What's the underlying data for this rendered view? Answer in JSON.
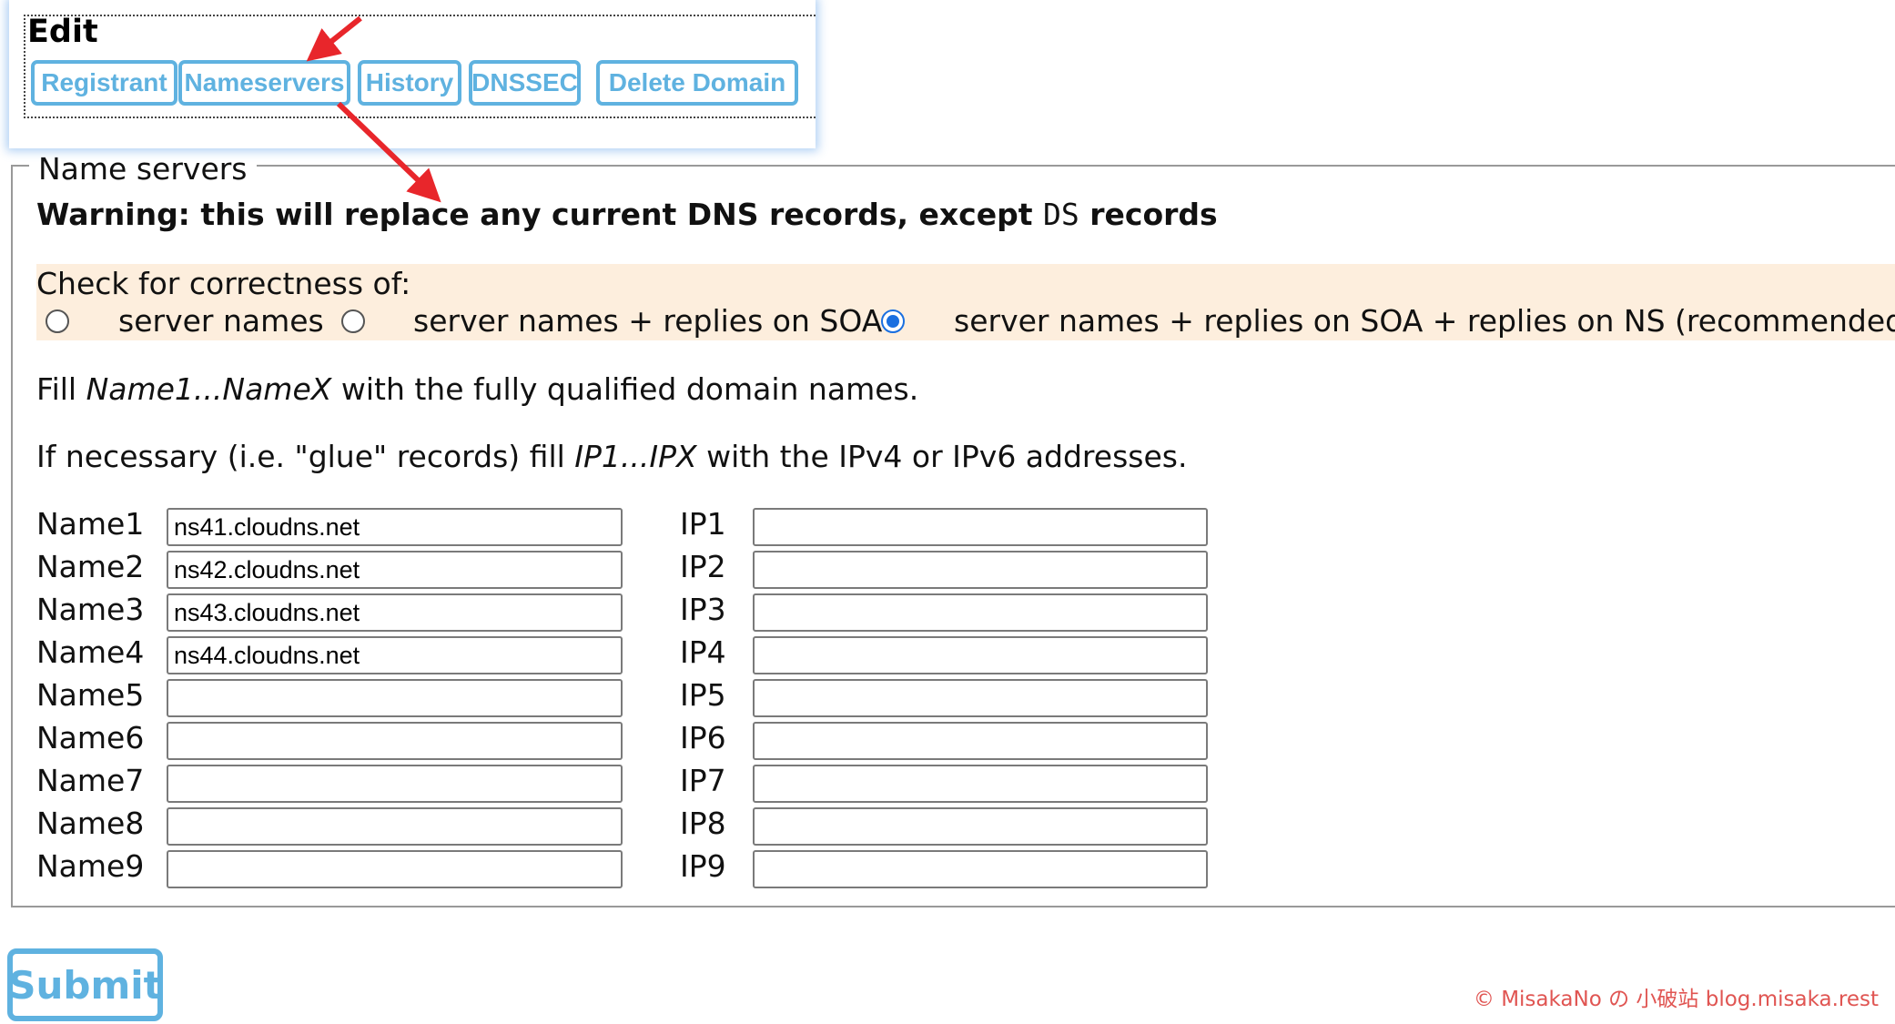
{
  "edit": {
    "title": "Edit",
    "tabs": [
      {
        "label": "Registrant"
      },
      {
        "label": "Nameservers"
      },
      {
        "label": "History"
      },
      {
        "label": "DNSSEC"
      },
      {
        "label": "Delete Domain"
      }
    ]
  },
  "nameservers": {
    "legend": "Name servers",
    "warning_prefix": "Warning: this will replace any current DNS records, except ",
    "warning_code": "DS",
    "warning_suffix": " records",
    "check_label": "Check for correctness of:",
    "check_options": [
      {
        "label": "server names",
        "selected": false
      },
      {
        "label": "server names + replies on SOA",
        "selected": false
      },
      {
        "label": "server names + replies on SOA + replies on NS (recommended)",
        "selected": true
      }
    ],
    "fill_names": {
      "pre": "Fill ",
      "em": "Name1...NameX",
      "post": " with the fully qualified domain names."
    },
    "fill_ips": {
      "pre": "If necessary (i.e. \"glue\" records) fill ",
      "em": "IP1...IPX",
      "post": " with the IPv4 or IPv6 addresses."
    },
    "rows": [
      {
        "name_label": "Name1",
        "name_value": "ns41.cloudns.net",
        "ip_label": "IP1",
        "ip_value": ""
      },
      {
        "name_label": "Name2",
        "name_value": "ns42.cloudns.net",
        "ip_label": "IP2",
        "ip_value": ""
      },
      {
        "name_label": "Name3",
        "name_value": "ns43.cloudns.net",
        "ip_label": "IP3",
        "ip_value": ""
      },
      {
        "name_label": "Name4",
        "name_value": "ns44.cloudns.net",
        "ip_label": "IP4",
        "ip_value": ""
      },
      {
        "name_label": "Name5",
        "name_value": "",
        "ip_label": "IP5",
        "ip_value": ""
      },
      {
        "name_label": "Name6",
        "name_value": "",
        "ip_label": "IP6",
        "ip_value": ""
      },
      {
        "name_label": "Name7",
        "name_value": "",
        "ip_label": "IP7",
        "ip_value": ""
      },
      {
        "name_label": "Name8",
        "name_value": "",
        "ip_label": "IP8",
        "ip_value": ""
      },
      {
        "name_label": "Name9",
        "name_value": "",
        "ip_label": "IP9",
        "ip_value": ""
      }
    ]
  },
  "submit_label": "Submit",
  "watermark": "© MisakaNo の 小破站 blog.misaka.rest",
  "colors": {
    "accent": "#5fb2e0",
    "radio_selected": "#1a6fe0",
    "annotation_arrow": "#e8262b",
    "band": "#fdeedd"
  }
}
